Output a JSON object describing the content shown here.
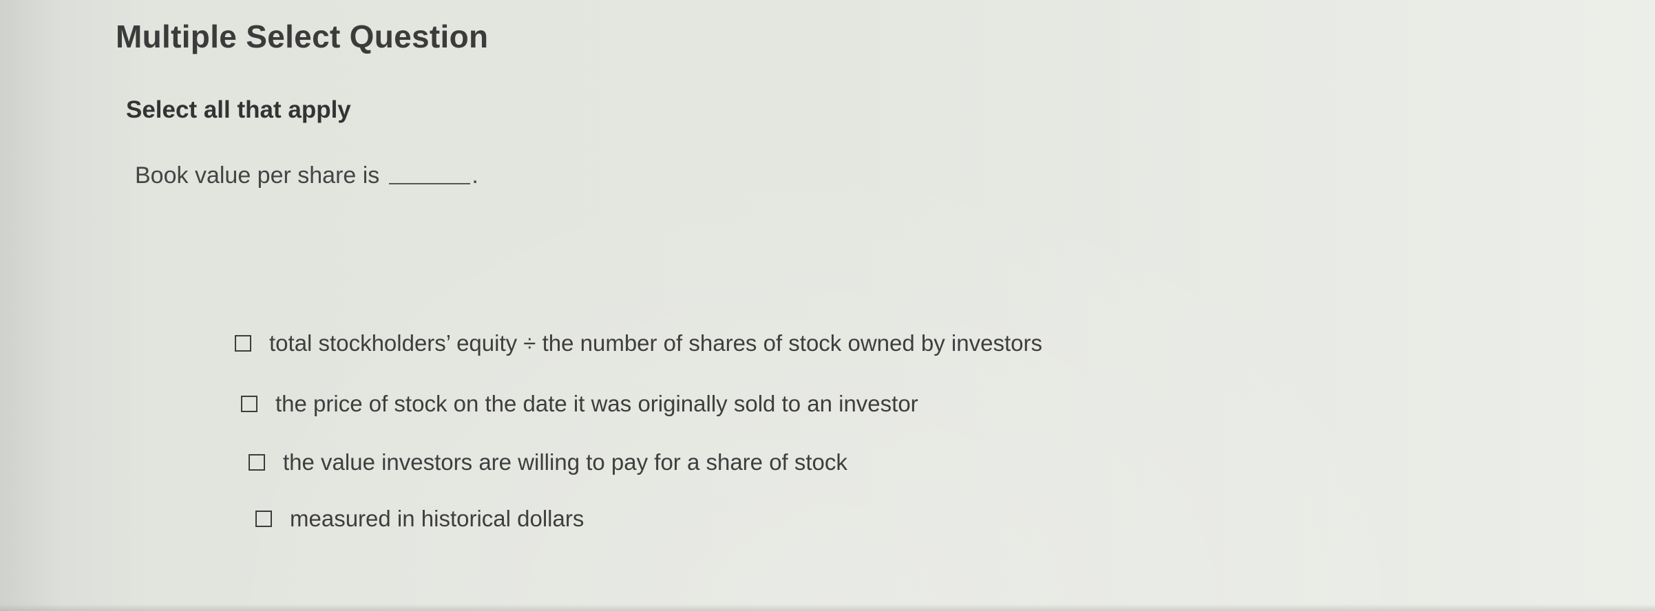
{
  "question": {
    "title": "Multiple Select Question",
    "instruction": "Select all that apply",
    "prompt": "Book value per share is",
    "prompt_end": "."
  },
  "options": [
    {
      "label": "total stockholders’ equity ÷ the number of shares of stock owned by investors",
      "checked": false
    },
    {
      "label": "the price of stock on the date it was originally sold to an investor",
      "checked": false
    },
    {
      "label": "the value investors are willing to pay for a share of stock",
      "checked": false
    },
    {
      "label": "measured in historical dollars",
      "checked": false
    }
  ]
}
